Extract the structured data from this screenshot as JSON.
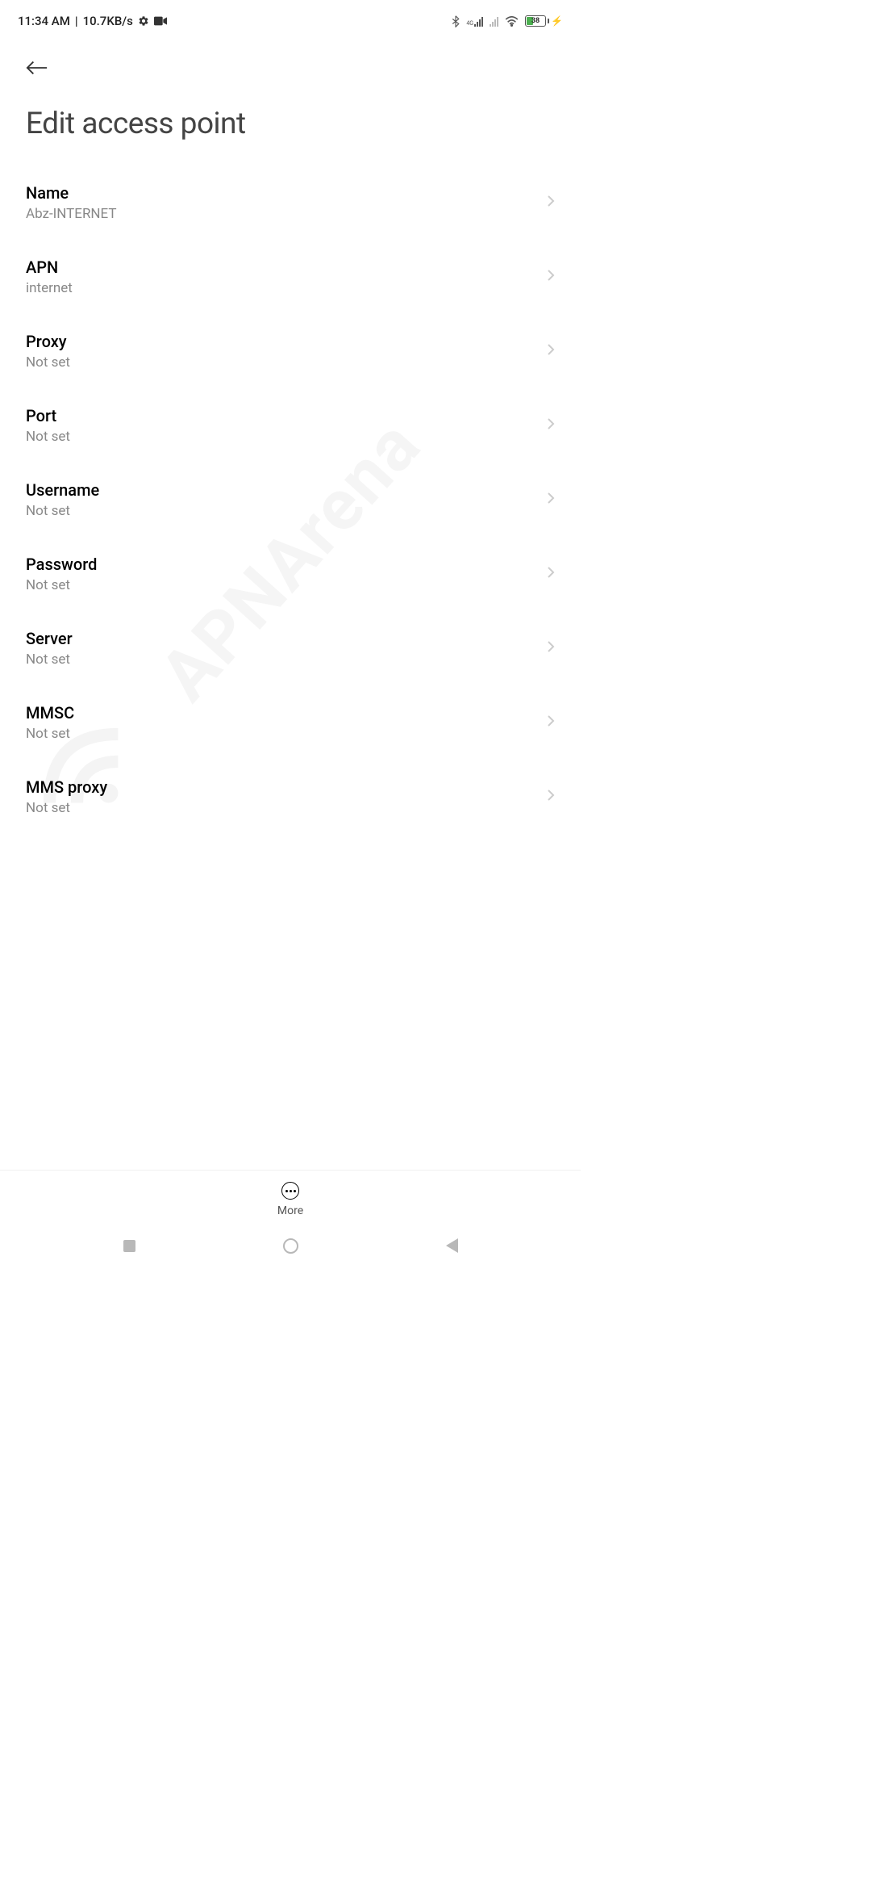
{
  "status_bar": {
    "time": "11:34 AM",
    "separator": "|",
    "speed": "10.7KB/s",
    "network_type": "4G",
    "battery_percent": "38"
  },
  "header": {
    "title": "Edit access point"
  },
  "items": [
    {
      "label": "Name",
      "value": "Abz-INTERNET"
    },
    {
      "label": "APN",
      "value": "internet"
    },
    {
      "label": "Proxy",
      "value": "Not set"
    },
    {
      "label": "Port",
      "value": "Not set"
    },
    {
      "label": "Username",
      "value": "Not set"
    },
    {
      "label": "Password",
      "value": "Not set"
    },
    {
      "label": "Server",
      "value": "Not set"
    },
    {
      "label": "MMSC",
      "value": "Not set"
    },
    {
      "label": "MMS proxy",
      "value": "Not set"
    }
  ],
  "bottom": {
    "more_label": "More"
  },
  "watermark": "APNArena"
}
